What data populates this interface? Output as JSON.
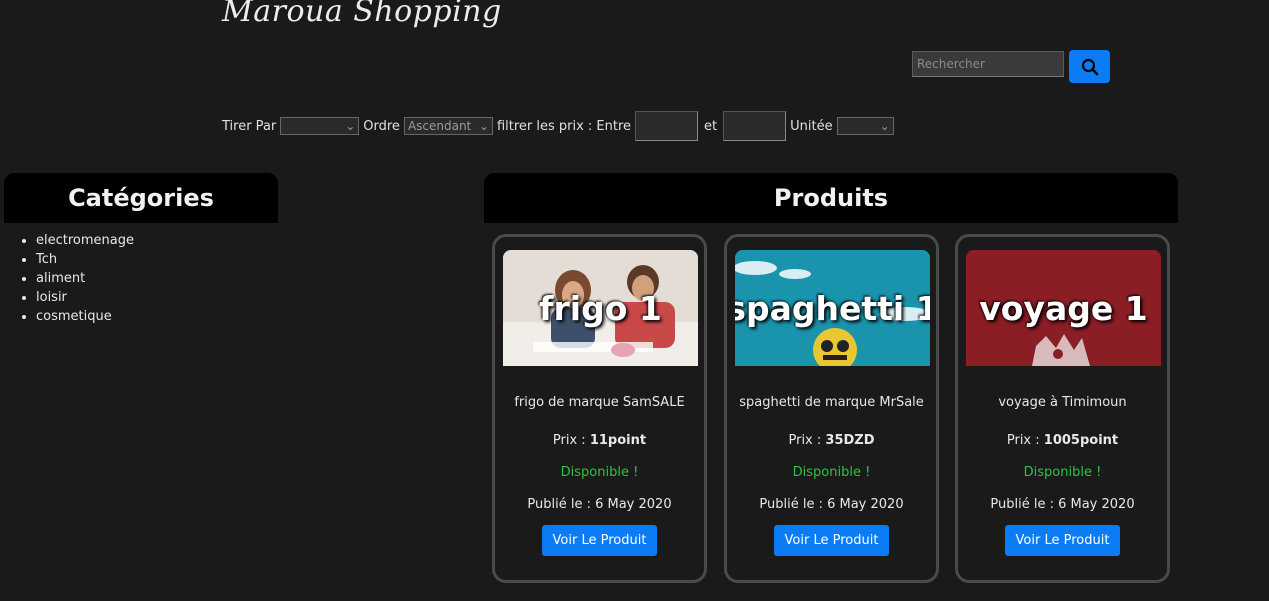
{
  "site_title": "Maroua Shopping",
  "search": {
    "placeholder": "Rechercher"
  },
  "filters": {
    "sort_label": "Tirer Par",
    "sort_value": "",
    "order_label": "Ordre",
    "order_value": "Ascendant",
    "price_label": "filtrer les prix : Entre",
    "and_label": "et",
    "unit_label": "Unitée",
    "unit_value": ""
  },
  "categories": {
    "title": "Catégories",
    "items": [
      "electromenage",
      "Tch",
      "aliment",
      "loisir",
      "cosmetique"
    ]
  },
  "products": {
    "title": "Produits",
    "items": [
      {
        "image_label": "frigo 1",
        "description": "frigo de marque SamSALE",
        "price_label": "Prix :",
        "price": "11point",
        "availability": "Disponible !",
        "published": "Publié le : 6 May 2020",
        "button": "Voir Le Produit"
      },
      {
        "image_label": "spaghetti 1",
        "description": "spaghetti de marque MrSale",
        "price_label": "Prix :",
        "price": "35DZD",
        "availability": "Disponible !",
        "published": "Publié le : 6 May 2020",
        "button": "Voir Le Produit"
      },
      {
        "image_label": "voyage 1",
        "description": "voyage à Timimoun",
        "price_label": "Prix :",
        "price": "1005point",
        "availability": "Disponible !",
        "published": "Publié le : 6 May 2020",
        "button": "Voir Le Produit"
      }
    ]
  },
  "colors": {
    "accent": "#0b7cf5",
    "available": "#2fc04a",
    "background": "#1a1a1a"
  }
}
